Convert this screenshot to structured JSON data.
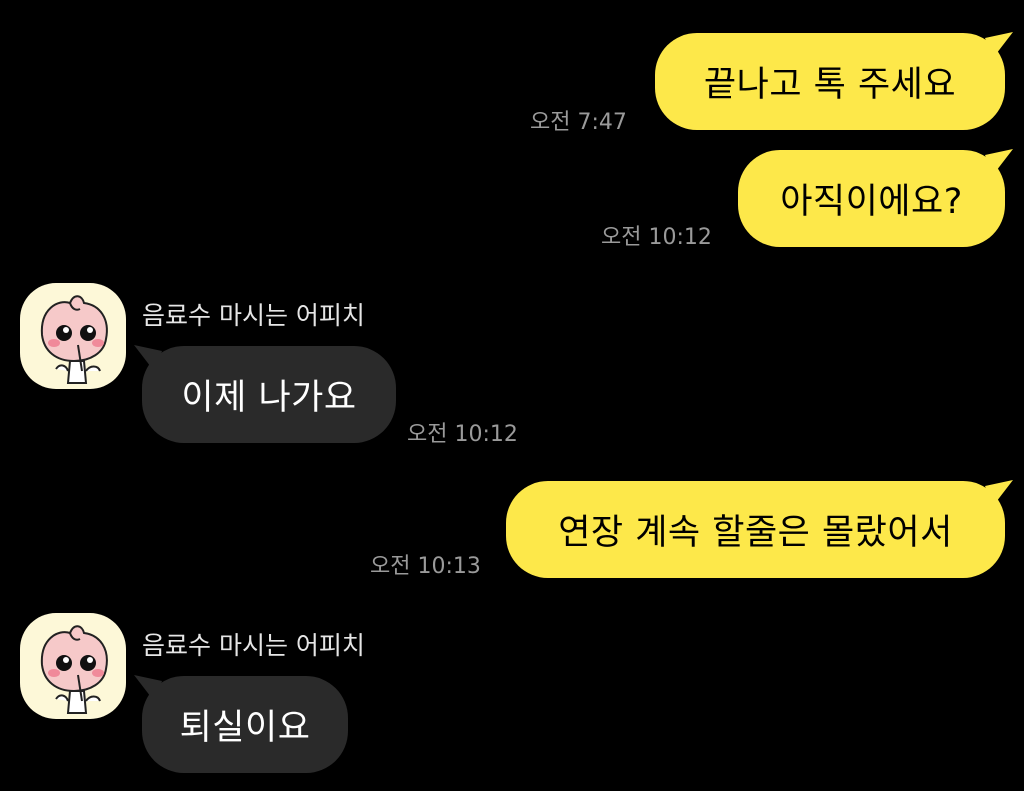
{
  "colors": {
    "background": "#000000",
    "my_bubble": "#fde84a",
    "their_bubble": "#2a2a2a",
    "time_text": "#9a9a9a",
    "sender_text": "#e6e6e6"
  },
  "messages": [
    {
      "side": "mine",
      "text": "끝나고 톡 주세요",
      "time": "오전 7:47"
    },
    {
      "side": "mine",
      "text": "아직이에요?",
      "time": "오전 10:12"
    },
    {
      "side": "theirs",
      "sender": "음료수 마시는 어피치",
      "avatar_icon": "apeach-drinking-icon",
      "text": "이제 나가요",
      "time": "오전 10:12"
    },
    {
      "side": "mine",
      "text": "연장 계속 할줄은 몰랐어서",
      "time": "오전 10:13"
    },
    {
      "side": "theirs",
      "sender": "음료수 마시는 어피치",
      "avatar_icon": "apeach-drinking-icon",
      "text": "퇴실이요"
    }
  ]
}
